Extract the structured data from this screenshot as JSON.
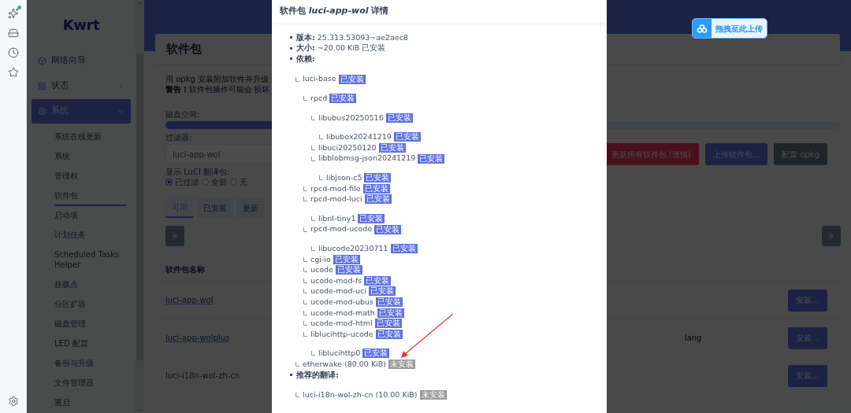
{
  "rail": {
    "items": [
      {
        "kind": "sparkle",
        "badge": true
      },
      {
        "kind": "drive",
        "badge": false
      },
      {
        "kind": "clock",
        "badge": false
      },
      {
        "kind": "star",
        "badge": false
      }
    ]
  },
  "sidebar": {
    "logo": "Kwrt",
    "items": [
      {
        "label": "网络向导",
        "active": false
      },
      {
        "label": "状态",
        "expanded": false,
        "active": false
      },
      {
        "label": "系统",
        "expanded": true,
        "active": true
      }
    ],
    "subitems": [
      {
        "label": "系统在线更新",
        "selected": false
      },
      {
        "label": "系统",
        "selected": false
      },
      {
        "label": "管理权",
        "selected": false
      },
      {
        "label": "软件包",
        "selected": true
      },
      {
        "label": "启动项",
        "selected": false
      },
      {
        "label": "计划任务",
        "selected": false
      },
      {
        "label": "Scheduled Tasks Helper",
        "selected": false
      },
      {
        "label": "挂载点",
        "selected": false
      },
      {
        "label": "分区扩容",
        "selected": false
      },
      {
        "label": "磁盘管理",
        "selected": false
      },
      {
        "label": "LED 配置",
        "selected": false
      },
      {
        "label": "备份与升级",
        "selected": false
      },
      {
        "label": "文件管理器",
        "selected": false
      },
      {
        "label": "重启",
        "selected": false
      }
    ]
  },
  "page": {
    "title": "软件包",
    "intro": "用 opkg 安装附加软件并升级",
    "warning": "**警告！**软件包操作可能会",
    "warning_link": "损坏",
    "disk_label": "磁盘空间:",
    "disk": {
      "level": 0.3
    },
    "filter_label": "过滤器:",
    "filter_value": "luci-app-wol",
    "show_label": "显示 LuCI 翻译包:",
    "radios": [
      {
        "label": "已过滤",
        "selected": true
      },
      {
        "label": "全部",
        "selected": false
      },
      {
        "label": "无",
        "selected": false
      }
    ],
    "actions": [
      {
        "label": "更新所有软件包 (谨慎)",
        "kind": "danger"
      },
      {
        "label": "上传软件包...",
        "kind": "primary"
      },
      {
        "label": "配置 opkg",
        "kind": "neutral"
      }
    ],
    "tabs": [
      {
        "label": "可用",
        "selected": true
      },
      {
        "label": "已安装",
        "selected": false
      },
      {
        "label": "更新",
        "selected": false
      }
    ],
    "prev": "«",
    "next": "»",
    "column": "软件包名称",
    "rows": [
      {
        "name": "luci-app-wol",
        "action": "安装..."
      },
      {
        "name": "luci-app-wolplus",
        "description": "lang",
        "action": "安装..."
      },
      {
        "name": "luci-i18n-wol-zh-cn",
        "action": "安装..."
      }
    ]
  },
  "upload_pill": {
    "label": "拖拽至此上传"
  },
  "dialog": {
    "title": "软件包 *luci-app-wol* 详情",
    "info": [
      {
        "label": "版本:",
        "value": "25.313.53093~ae2aec8"
      },
      {
        "label": "大小:",
        "value": "~20.00 KiB 已安装"
      },
      {
        "label": "依赖:"
      }
    ],
    "deps": [
      {
        "name": "luci-base",
        "installed": true,
        "badge": "已安装",
        "children": [
          {
            "name": "rpcd",
            "installed": true,
            "badge": "已安装",
            "children": [
              {
                "name": "libubus20250516",
                "installed": true,
                "badge": "已安装",
                "children": [
                  {
                    "name": "libubox20241219",
                    "installed": true,
                    "badge": "已安装"
                  }
                ]
              },
              {
                "name": "libuci20250120",
                "installed": true,
                "badge": "已安装"
              },
              {
                "name": "libblobmsg-json20241219",
                "installed": true,
                "badge": "已安装",
                "children": [
                  {
                    "name": "libjson-c5",
                    "installed": true,
                    "badge": "已安装"
                  }
                ]
              }
            ]
          },
          {
            "name": "rpcd-mod-file",
            "installed": true,
            "badge": "已安装"
          },
          {
            "name": "rpcd-mod-luci",
            "installed": true,
            "badge": "已安装",
            "children": [
              {
                "name": "libnl-tiny1",
                "installed": true,
                "badge": "已安装"
              }
            ]
          },
          {
            "name": "rpcd-mod-ucode",
            "installed": true,
            "badge": "已安装",
            "children": [
              {
                "name": "libucode20230711",
                "installed": true,
                "badge": "已安装"
              }
            ]
          },
          {
            "name": "cgi-io",
            "installed": true,
            "badge": "已安装"
          },
          {
            "name": "ucode",
            "installed": true,
            "badge": "已安装"
          },
          {
            "name": "ucode-mod-fs",
            "installed": true,
            "badge": "已安装"
          },
          {
            "name": "ucode-mod-uci",
            "installed": true,
            "badge": "已安装"
          },
          {
            "name": "ucode-mod-ubus",
            "installed": true,
            "badge": "已安装"
          },
          {
            "name": "ucode-mod-math",
            "installed": true,
            "badge": "已安装"
          },
          {
            "name": "ucode-mod-html",
            "installed": true,
            "badge": "已安装"
          },
          {
            "name": "liblucihttp-ucode",
            "installed": true,
            "badge": "已安装",
            "children": [
              {
                "name": "liblucihttp0",
                "installed": true,
                "badge": "已安装"
              }
            ]
          }
        ]
      },
      {
        "name": "etherwake (80.00 KiB)",
        "installed": false,
        "badge": "未安装"
      }
    ],
    "translations_label": "推荐的翻译:",
    "translations": [
      {
        "name": "luci-i18n-wol-zh-cn (10.00 KiB)",
        "installed": false,
        "badge": "未安装"
      }
    ]
  }
}
